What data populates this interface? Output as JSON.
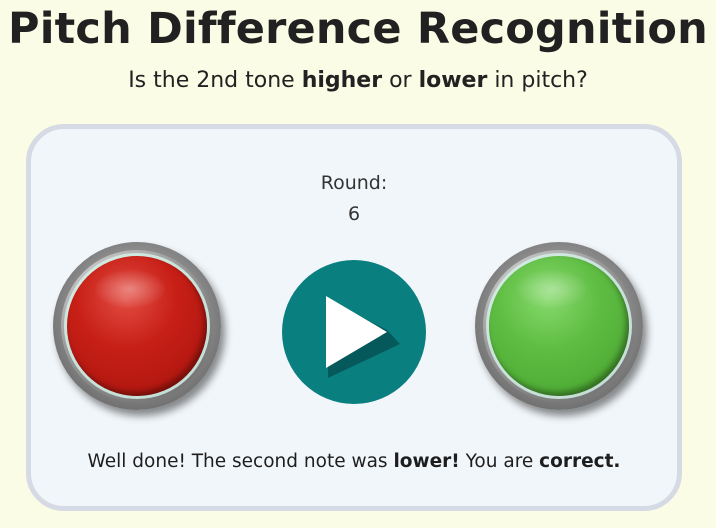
{
  "header": {
    "title": "Pitch Difference Recognition",
    "question_prefix": "Is the 2nd tone ",
    "question_higher": "higher",
    "question_or": " or ",
    "question_lower": "lower",
    "question_suffix": " in pitch?"
  },
  "game": {
    "round_label": "Round:",
    "round_value": "6"
  },
  "buttons": {
    "lower": {
      "icon": "red-arcade-button",
      "color": "#c71f16"
    },
    "play": {
      "icon": "play-icon",
      "color": "#0a7f80"
    },
    "higher": {
      "icon": "green-arcade-button",
      "color": "#5fbd43"
    }
  },
  "feedback": {
    "prefix": "Well done! The second note was ",
    "answer": "lower!",
    "middle": " You are ",
    "result": "correct."
  }
}
